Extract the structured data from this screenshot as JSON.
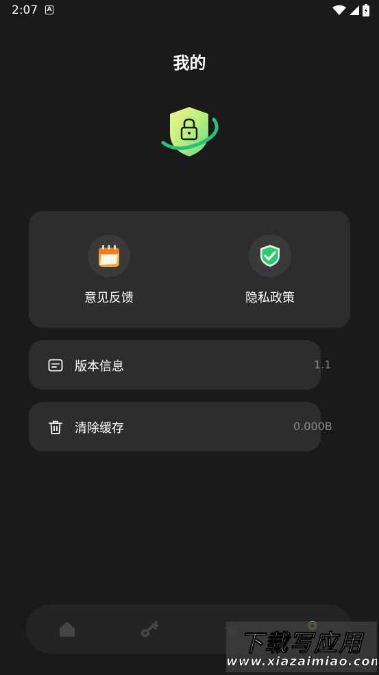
{
  "status_bar": {
    "time": "2:07",
    "notification_letter": "A"
  },
  "header": {
    "title": "我的"
  },
  "quick_actions": [
    {
      "label": "意见反馈",
      "icon": "calendar-notepad-icon"
    },
    {
      "label": "隐私政策",
      "icon": "shield-check-icon"
    }
  ],
  "settings": [
    {
      "label": "版本信息",
      "value": "1.1",
      "icon": "message-box-icon"
    },
    {
      "label": "清除缓存",
      "value": "0.000B",
      "icon": "trash-icon"
    }
  ],
  "bottom_nav": [
    {
      "name": "home",
      "icon": "home-icon"
    },
    {
      "name": "key",
      "icon": "key-icon"
    },
    {
      "name": "tools",
      "icon": "tool-icon"
    },
    {
      "name": "mine",
      "icon": "profile-icon",
      "active": true
    }
  ],
  "watermark": {
    "main": "下载写应用",
    "sub": "www.xiazaimiao.com"
  },
  "colors": {
    "background": "#1a1a1a",
    "card": "#2d2d2d",
    "accent_green": "#2ecc71",
    "muted_text": "#8a8a8a"
  }
}
